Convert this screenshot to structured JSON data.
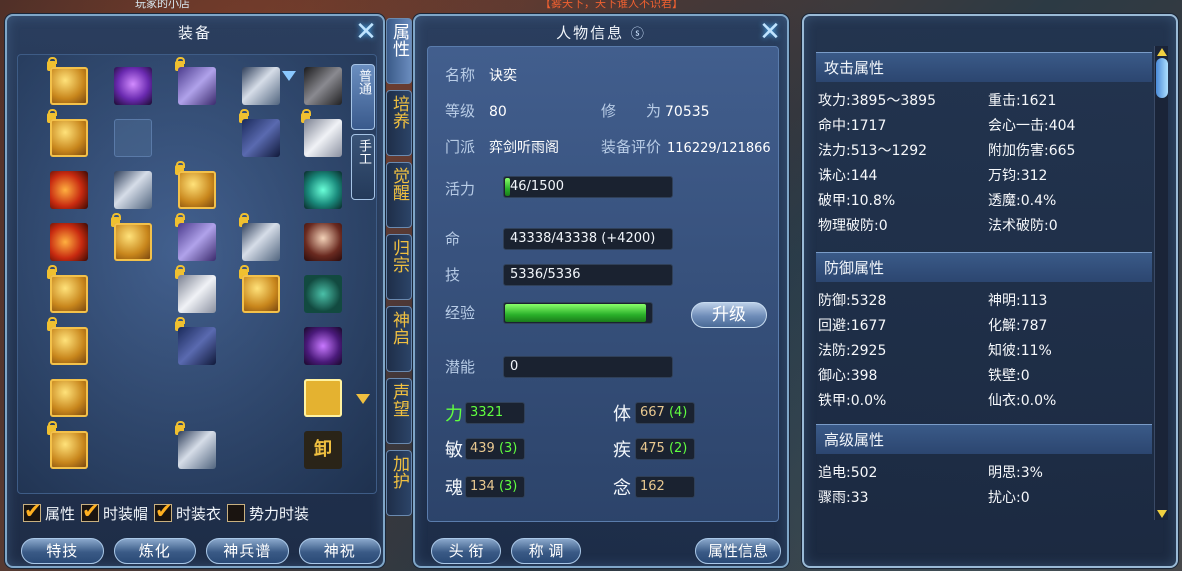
{
  "ticker": {
    "left": "玩家的小店",
    "center": "【雾天下，天下谁人不识君】"
  },
  "equip": {
    "title": "装备",
    "close": "✕",
    "tabs": [
      "普通",
      "手工"
    ],
    "checkboxes": [
      {
        "label": "属性",
        "checked": true
      },
      {
        "label": "时装帽",
        "checked": true
      },
      {
        "label": "时装衣",
        "checked": true
      },
      {
        "label": "势力时装",
        "checked": false
      }
    ],
    "buttons": [
      "特技",
      "炼化",
      "神兵谱",
      "神祝"
    ],
    "special_slot": "卸"
  },
  "side_tabs": [
    "属性",
    "培养",
    "觉醒",
    "归宗",
    "神启",
    "声望",
    "加护"
  ],
  "info": {
    "title": "人物信息",
    "title_icon": "ⓢ",
    "close": "✕",
    "name_label": "名称",
    "name": "诀奕",
    "level_label": "等级",
    "level": "80",
    "cultivation_label": "修　　为",
    "cultivation": "70535",
    "sect_label": "门派",
    "sect": "弈剑听雨阁",
    "rating_label": "装备评价",
    "rating": "116229/121866",
    "vigor_label": "活力",
    "vigor": "46/1500",
    "vigor_fraction": 0.03,
    "hp_label": "命",
    "hp": "43338/43338 (+4200)",
    "skill_label": "技",
    "skill": "5336/5336",
    "exp_label": "经验",
    "exp_fraction": 0.95,
    "upgrade": "升级",
    "potential_label": "潜能",
    "potential": "0",
    "stats": [
      {
        "label": "力",
        "value": "3321",
        "bonus": ""
      },
      {
        "label": "体",
        "value": "667",
        "bonus": "(4)"
      },
      {
        "label": "敏",
        "value": "439",
        "bonus": "(3)"
      },
      {
        "label": "疾",
        "value": "475",
        "bonus": "(2)"
      },
      {
        "label": "魂",
        "value": "134",
        "bonus": "(3)"
      },
      {
        "label": "念",
        "value": "162",
        "bonus": ""
      }
    ],
    "bottom_buttons": [
      "头 衔",
      "称 调",
      "属性信息"
    ]
  },
  "attr": {
    "sections": [
      {
        "title": "攻击属性",
        "lines": [
          [
            "攻力:3895～3895",
            "重击:1621"
          ],
          [
            "命中:1717",
            "会心一击:404"
          ],
          [
            "法力:513～1292",
            "附加伤害:665"
          ],
          [
            "诛心:144",
            "万钧:312"
          ],
          [
            "破甲:10.8%",
            "透魔:0.4%"
          ],
          [
            "物理破防:0",
            "法术破防:0"
          ]
        ]
      },
      {
        "title": "防御属性",
        "lines": [
          [
            "防御:5328",
            "神明:113"
          ],
          [
            "回避:1677",
            "化解:787"
          ],
          [
            "法防:2925",
            "知彼:11%"
          ],
          [
            "御心:398",
            "铁壁:0"
          ],
          [
            "铁甲:0.0%",
            "仙衣:0.0%"
          ]
        ]
      },
      {
        "title": "高级属性",
        "lines": [
          [
            "追电:502",
            "明思:3%"
          ],
          [
            "骤雨:33",
            "扰心:0"
          ]
        ]
      }
    ]
  },
  "colors": {
    "accent_gold": "#f0c040",
    "exp_green": "#2ab02a",
    "bonus_green": "#60ff40",
    "panel_blue": "#2c4670"
  }
}
